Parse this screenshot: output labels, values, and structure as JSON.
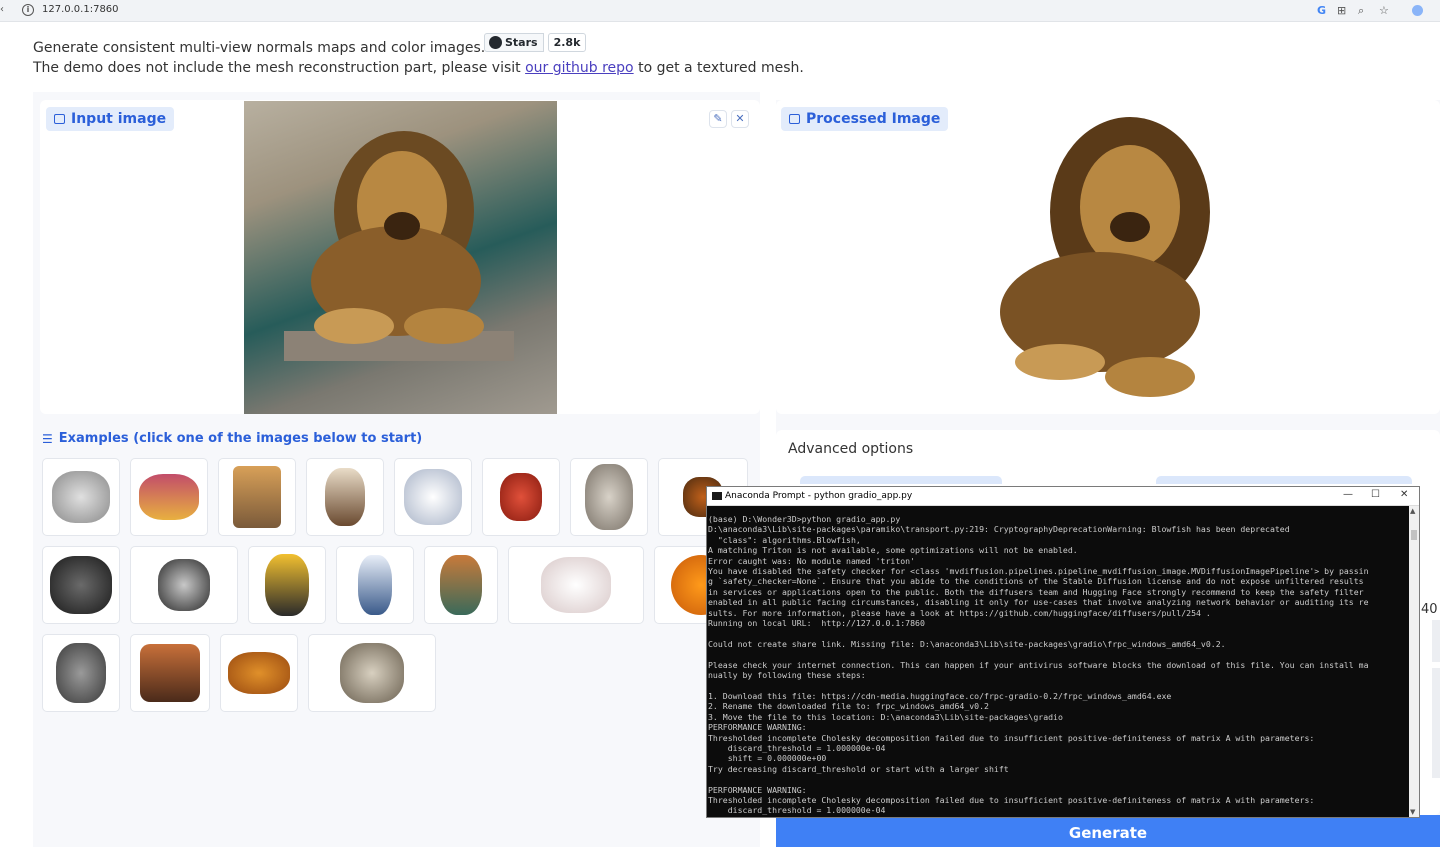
{
  "browser": {
    "url": "127.0.0.1:7860"
  },
  "header": {
    "line1": "Generate consistent multi-view normals maps and color images.",
    "line2_prefix": "The demo does not include the mesh reconstruction part, please visit ",
    "link_text": "our github repo",
    "line2_suffix": " to get a textured mesh.",
    "stars_label": "Stars",
    "stars_count": "2.8k"
  },
  "input_panel": {
    "label": "Input image"
  },
  "processed_panel": {
    "label": "Processed Image"
  },
  "examples": {
    "title": "Examples (click one of the images below to start)",
    "items": [
      "tiger-head",
      "ornate-box",
      "bread-basket",
      "cat-figure",
      "cartoon-cat",
      "tomato-creature",
      "doll-figure",
      "pumpkin-small",
      "helmet",
      "teapot-metal",
      "duck-figure",
      "vase",
      "owl-figure",
      "pig-plush",
      "jack-o-lantern",
      "skull",
      "rock-sculpture",
      "teapot-clay",
      "lion-head"
    ]
  },
  "advanced": {
    "label": "Advanced options",
    "side_value": "40"
  },
  "generate": {
    "label": "Generate"
  },
  "terminal": {
    "title": "Anaconda Prompt - python  gradio_app.py",
    "lines": [
      "(base) D:\\Wonder3D>python gradio_app.py",
      "D:\\anaconda3\\Lib\\site-packages\\paramiko\\transport.py:219: CryptographyDeprecationWarning: Blowfish has been deprecated",
      "  \"class\": algorithms.Blowfish,",
      "A matching Triton is not available, some optimizations will not be enabled.",
      "Error caught was: No module named 'triton'",
      "You have disabled the safety checker for <class 'mvdiffusion.pipelines.pipeline_mvdiffusion_image.MVDiffusionImagePipeline'> by passin",
      "g `safety_checker=None`. Ensure that you abide to the conditions of the Stable Diffusion license and do not expose unfiltered results",
      "in services or applications open to the public. Both the diffusers team and Hugging Face strongly recommend to keep the safety filter",
      "enabled in all public facing circumstances, disabling it only for use-cases that involve analyzing network behavior or auditing its re",
      "sults. For more information, please have a look at https://github.com/huggingface/diffusers/pull/254 .",
      "Running on local URL:  http://127.0.0.1:7860",
      "",
      "Could not create share link. Missing file: D:\\anaconda3\\Lib\\site-packages\\gradio\\frpc_windows_amd64_v0.2.",
      "",
      "Please check your internet connection. This can happen if your antivirus software blocks the download of this file. You can install ma",
      "nually by following these steps:",
      "",
      "1. Download this file: https://cdn-media.huggingface.co/frpc-gradio-0.2/frpc_windows_amd64.exe",
      "2. Rename the downloaded file to: frpc_windows_amd64_v0.2",
      "3. Move the file to this location: D:\\anaconda3\\Lib\\site-packages\\gradio",
      "PERFORMANCE WARNING:",
      "Thresholded incomplete Cholesky decomposition failed due to insufficient positive-definiteness of matrix A with parameters:",
      "    discard_threshold = 1.000000e-04",
      "    shift = 0.000000e+00",
      "Try decreasing discard_threshold or start with a larger shift",
      "",
      "PERFORMANCE WARNING:",
      "Thresholded incomplete Cholesky decomposition failed due to insufficient positive-definiteness of matrix A with parameters:",
      "    discard_threshold = 1.000000e-04"
    ]
  },
  "colors": {
    "accent": "#2b5fd9",
    "generate": "#3f80f5",
    "label_bg": "#e3ecfb"
  }
}
